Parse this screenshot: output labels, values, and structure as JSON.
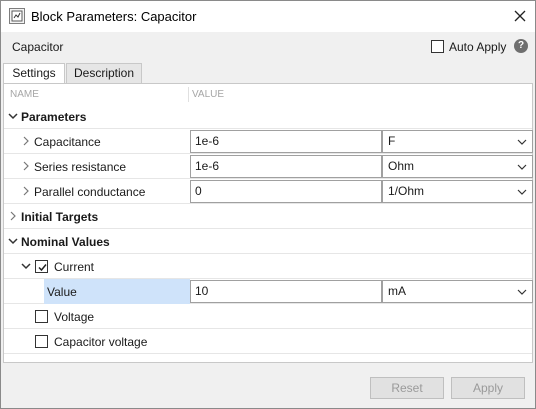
{
  "window": {
    "title": "Block Parameters: Capacitor"
  },
  "header": {
    "block_name": "Capacitor",
    "auto_apply_label": "Auto Apply",
    "auto_apply_checked": false,
    "help_glyph": "?"
  },
  "tabs": [
    {
      "label": "Settings",
      "active": true
    },
    {
      "label": "Description",
      "active": false
    }
  ],
  "grid": {
    "columns": {
      "name": "NAME",
      "value": "VALUE"
    },
    "parameters": {
      "label": "Parameters",
      "rows": [
        {
          "name": "Capacitance",
          "value": "1e-6",
          "unit": "F"
        },
        {
          "name": "Series resistance",
          "value": "1e-6",
          "unit": "Ohm"
        },
        {
          "name": "Parallel conductance",
          "value": "0",
          "unit": "1/Ohm"
        }
      ]
    },
    "initial_targets": {
      "label": "Initial Targets"
    },
    "nominal_values": {
      "label": "Nominal Values",
      "current": {
        "label": "Current",
        "checked": true,
        "value_row": {
          "name": "Value",
          "value": "10",
          "unit": "mA"
        }
      },
      "voltage": {
        "label": "Voltage",
        "checked": false
      },
      "capacitor_voltage": {
        "label": "Capacitor voltage",
        "checked": false
      }
    }
  },
  "buttons": {
    "reset_label": "Reset",
    "apply_label": "Apply"
  },
  "icons": {
    "app": "block-parameters-icon",
    "close": "close-icon",
    "help": "help-icon",
    "expand": "chevron-right-icon",
    "collapse": "chevron-down-icon",
    "dropdown": "dropdown-arrow-icon",
    "check": "checkmark-icon"
  },
  "colors": {
    "selection": "#cfe3fa",
    "disabled_text": "#9a9a9a",
    "header_text": "#a6a6a6"
  }
}
